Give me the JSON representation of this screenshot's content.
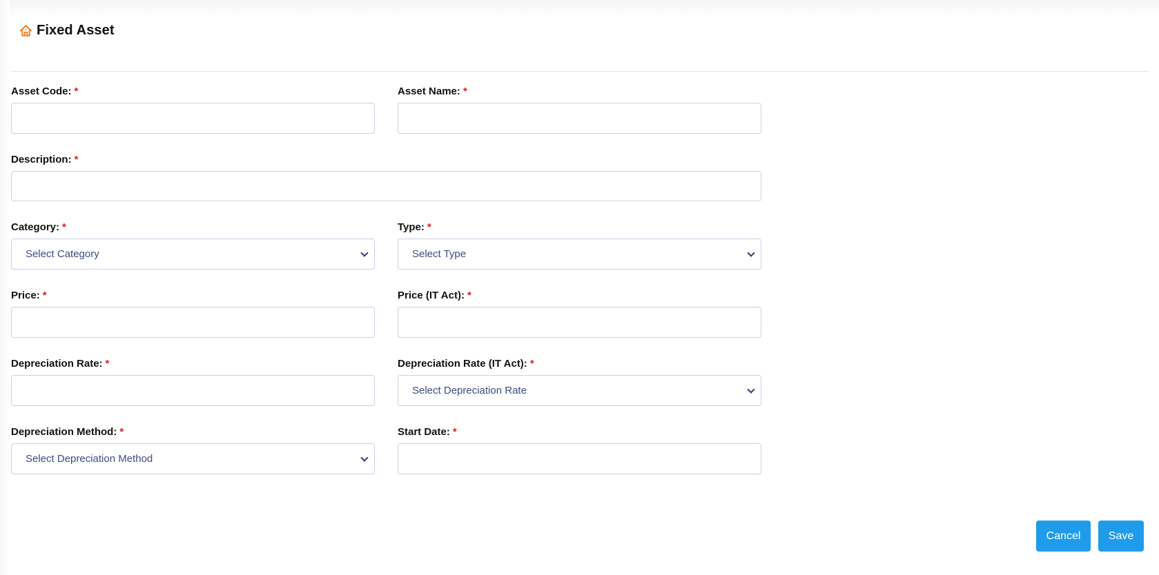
{
  "header": {
    "icon": "home-icon",
    "title": "Fixed Asset",
    "icon_color": "#f47c20"
  },
  "form": {
    "required_marker": "*",
    "asset_code": {
      "label": "Asset Code:",
      "value": "",
      "placeholder": ""
    },
    "asset_name": {
      "label": "Asset Name:",
      "value": "",
      "placeholder": ""
    },
    "description": {
      "label": "Description:",
      "value": "",
      "placeholder": ""
    },
    "category": {
      "label": "Category:",
      "selected": "Select Category"
    },
    "type": {
      "label": "Type:",
      "selected": "Select Type"
    },
    "price": {
      "label": "Price:",
      "value": "",
      "placeholder": ""
    },
    "price_it_act": {
      "label": "Price (IT Act):",
      "value": "",
      "placeholder": ""
    },
    "depreciation_rate": {
      "label": "Depreciation Rate:",
      "value": "",
      "placeholder": ""
    },
    "depreciation_rate_it_act": {
      "label": "Depreciation Rate (IT Act):",
      "selected": "Select Depreciation Rate"
    },
    "depreciation_method": {
      "label": "Depreciation Method:",
      "selected": "Select Depreciation Method"
    },
    "start_date": {
      "label": "Start Date:",
      "value": "",
      "placeholder": ""
    }
  },
  "actions": {
    "cancel_label": "Cancel",
    "save_label": "Save",
    "button_color": "#1f9bea"
  }
}
